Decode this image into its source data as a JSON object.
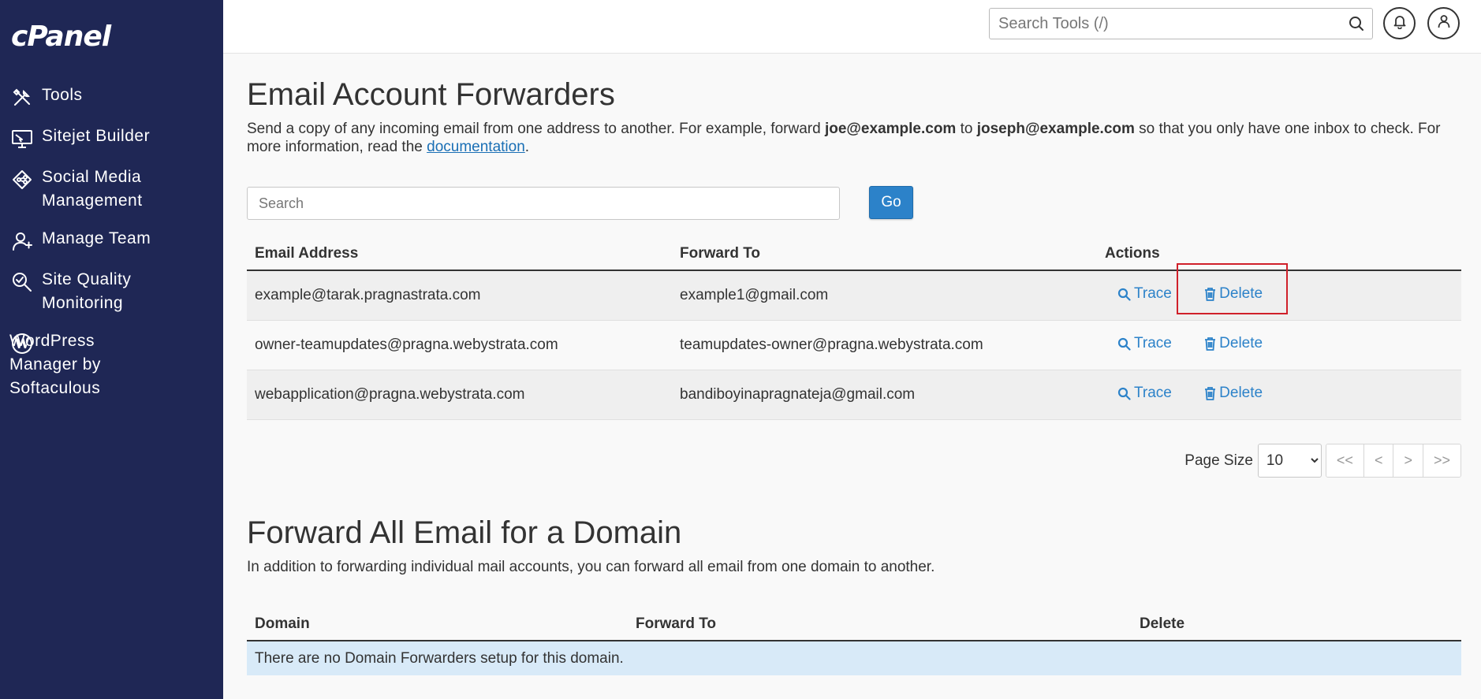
{
  "sidebar": {
    "logo": "cPanel",
    "items": [
      {
        "label": "Tools",
        "icon": "tools-icon"
      },
      {
        "label": "Sitejet Builder",
        "icon": "monitor-builder-icon"
      },
      {
        "label": "Social Media\nManagement",
        "icon": "social-media-icon"
      },
      {
        "label": "Manage Team",
        "icon": "manage-team-icon"
      },
      {
        "label": "Site Quality\nMonitoring",
        "icon": "site-quality-icon"
      },
      {
        "label": "WordPress\n Manager by\nSoftaculous",
        "icon": "wordpress-icon"
      }
    ]
  },
  "topbar": {
    "search_placeholder": "Search Tools (/)",
    "notifications_icon": "bell-icon",
    "user_icon": "user-icon"
  },
  "forwarders": {
    "title": "Email Account Forwarders",
    "desc_part1": "Send a copy of any incoming email from one address to another. For example, forward ",
    "desc_bold1": "joe@example.com",
    "desc_part2": " to ",
    "desc_bold2": "joseph@example.com",
    "desc_part3": " so that you only have one inbox to check. For more information, read the ",
    "desc_link": "documentation",
    "desc_end": ".",
    "search_placeholder": "Search",
    "go_label": "Go",
    "columns": [
      "Email Address",
      "Forward To",
      "Actions"
    ],
    "rows": [
      {
        "email": "example@tarak.pragnastrata.com",
        "forward_to": "example1@gmail.com"
      },
      {
        "email": "owner-teamupdates@pragna.webystrata.com",
        "forward_to": "teamupdates-owner@pragna.webystrata.com"
      },
      {
        "email": "webapplication@pragna.webystrata.com",
        "forward_to": "bandiboyinapragnateja@gmail.com"
      }
    ],
    "trace_label": "Trace",
    "delete_label": "Delete",
    "accent_color": "#2c82c9",
    "highlight_color": "#d0202a"
  },
  "pagination": {
    "page_size_label": "Page Size",
    "page_size_value": "10",
    "first": "<<",
    "prev": "<",
    "next": ">",
    "last": ">>"
  },
  "domain_forwarders": {
    "title": "Forward All Email for a Domain",
    "desc": "In addition to forwarding individual mail accounts, you can forward all email from one domain to another.",
    "columns": [
      "Domain",
      "Forward To",
      "Delete"
    ],
    "empty_message": "There are no Domain Forwarders setup for this domain."
  }
}
